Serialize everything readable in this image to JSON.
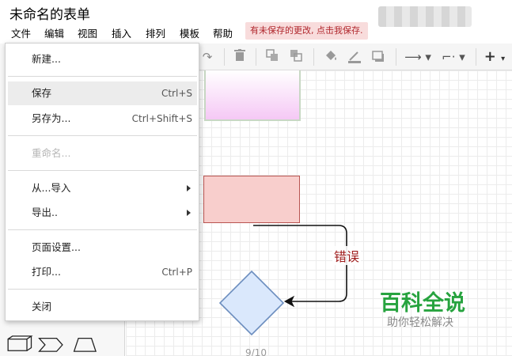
{
  "window": {
    "title": "未命名的表单"
  },
  "menubar": {
    "items": [
      "文件",
      "编辑",
      "视图",
      "插入",
      "排列",
      "模板",
      "帮助"
    ],
    "unsaved_notice": "有未保存的更改, 点击我保存."
  },
  "toolbar": {
    "icons": [
      "redo-icon",
      "delete-icon",
      "to-front-icon",
      "to-back-icon",
      "fill-color-icon",
      "line-color-icon",
      "shadow-icon",
      "connection-arrow-icon",
      "waypoints-icon",
      "insert-plus-icon"
    ]
  },
  "file_menu": {
    "new": "新建...",
    "save": "保存",
    "save_shortcut": "Ctrl+S",
    "save_as": "另存为...",
    "save_as_shortcut": "Ctrl+Shift+S",
    "rename": "重命名...",
    "import_from": "从...导入",
    "export": "导出..",
    "page_setup": "页面设置...",
    "print": "打印...",
    "print_shortcut": "Ctrl+P",
    "close": "关闭"
  },
  "canvas": {
    "edge_label": "错误",
    "page_indicator": "9/10",
    "colors": {
      "red_box_fill": "#f8cecc",
      "red_box_stroke": "#b85450",
      "diamond_fill": "#dae8fc",
      "diamond_stroke": "#6c8ebf",
      "edge_label_color": "#9e1b1b"
    }
  },
  "watermark": {
    "title": "百科全说",
    "subtitle": "助你轻松解决"
  }
}
